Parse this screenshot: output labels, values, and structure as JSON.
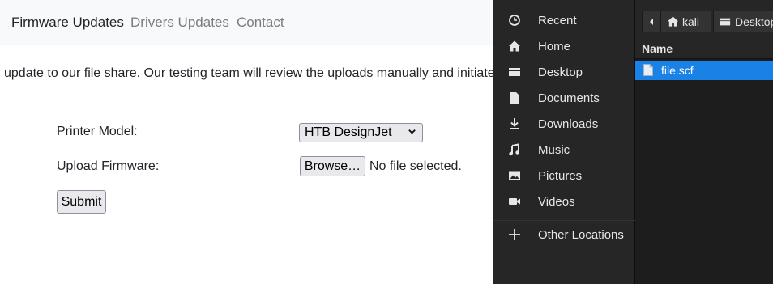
{
  "navbar": {
    "brand": "Firmware Updates",
    "links": [
      "Drivers Updates",
      "Contact"
    ]
  },
  "main": {
    "intro_text": "update to our file share. Our testing team will review the uploads manually and initiate",
    "form": {
      "printer_model_label": "Printer Model:",
      "printer_model_value": "HTB DesignJet",
      "upload_label": "Upload Firmware:",
      "browse_label": "Browse…",
      "file_status": "No file selected.",
      "submit_label": "Submit"
    }
  },
  "file_dialog": {
    "sidebar": [
      {
        "label": "Recent",
        "icon": "clock-icon"
      },
      {
        "label": "Home",
        "icon": "home-icon"
      },
      {
        "label": "Desktop",
        "icon": "desktop-icon"
      },
      {
        "label": "Documents",
        "icon": "document-icon"
      },
      {
        "label": "Downloads",
        "icon": "download-icon"
      },
      {
        "label": "Music",
        "icon": "music-icon"
      },
      {
        "label": "Pictures",
        "icon": "picture-icon"
      },
      {
        "label": "Videos",
        "icon": "video-icon"
      },
      {
        "label": "Other Locations",
        "icon": "plus-icon"
      }
    ],
    "path": [
      "kali",
      "Desktop"
    ],
    "column_header": "Name",
    "files": [
      {
        "name": "file.scf",
        "selected": true
      }
    ],
    "colors": {
      "sidebar_bg": "#262626",
      "list_bg": "#1d1d1d",
      "selection": "#1a81e6"
    }
  }
}
